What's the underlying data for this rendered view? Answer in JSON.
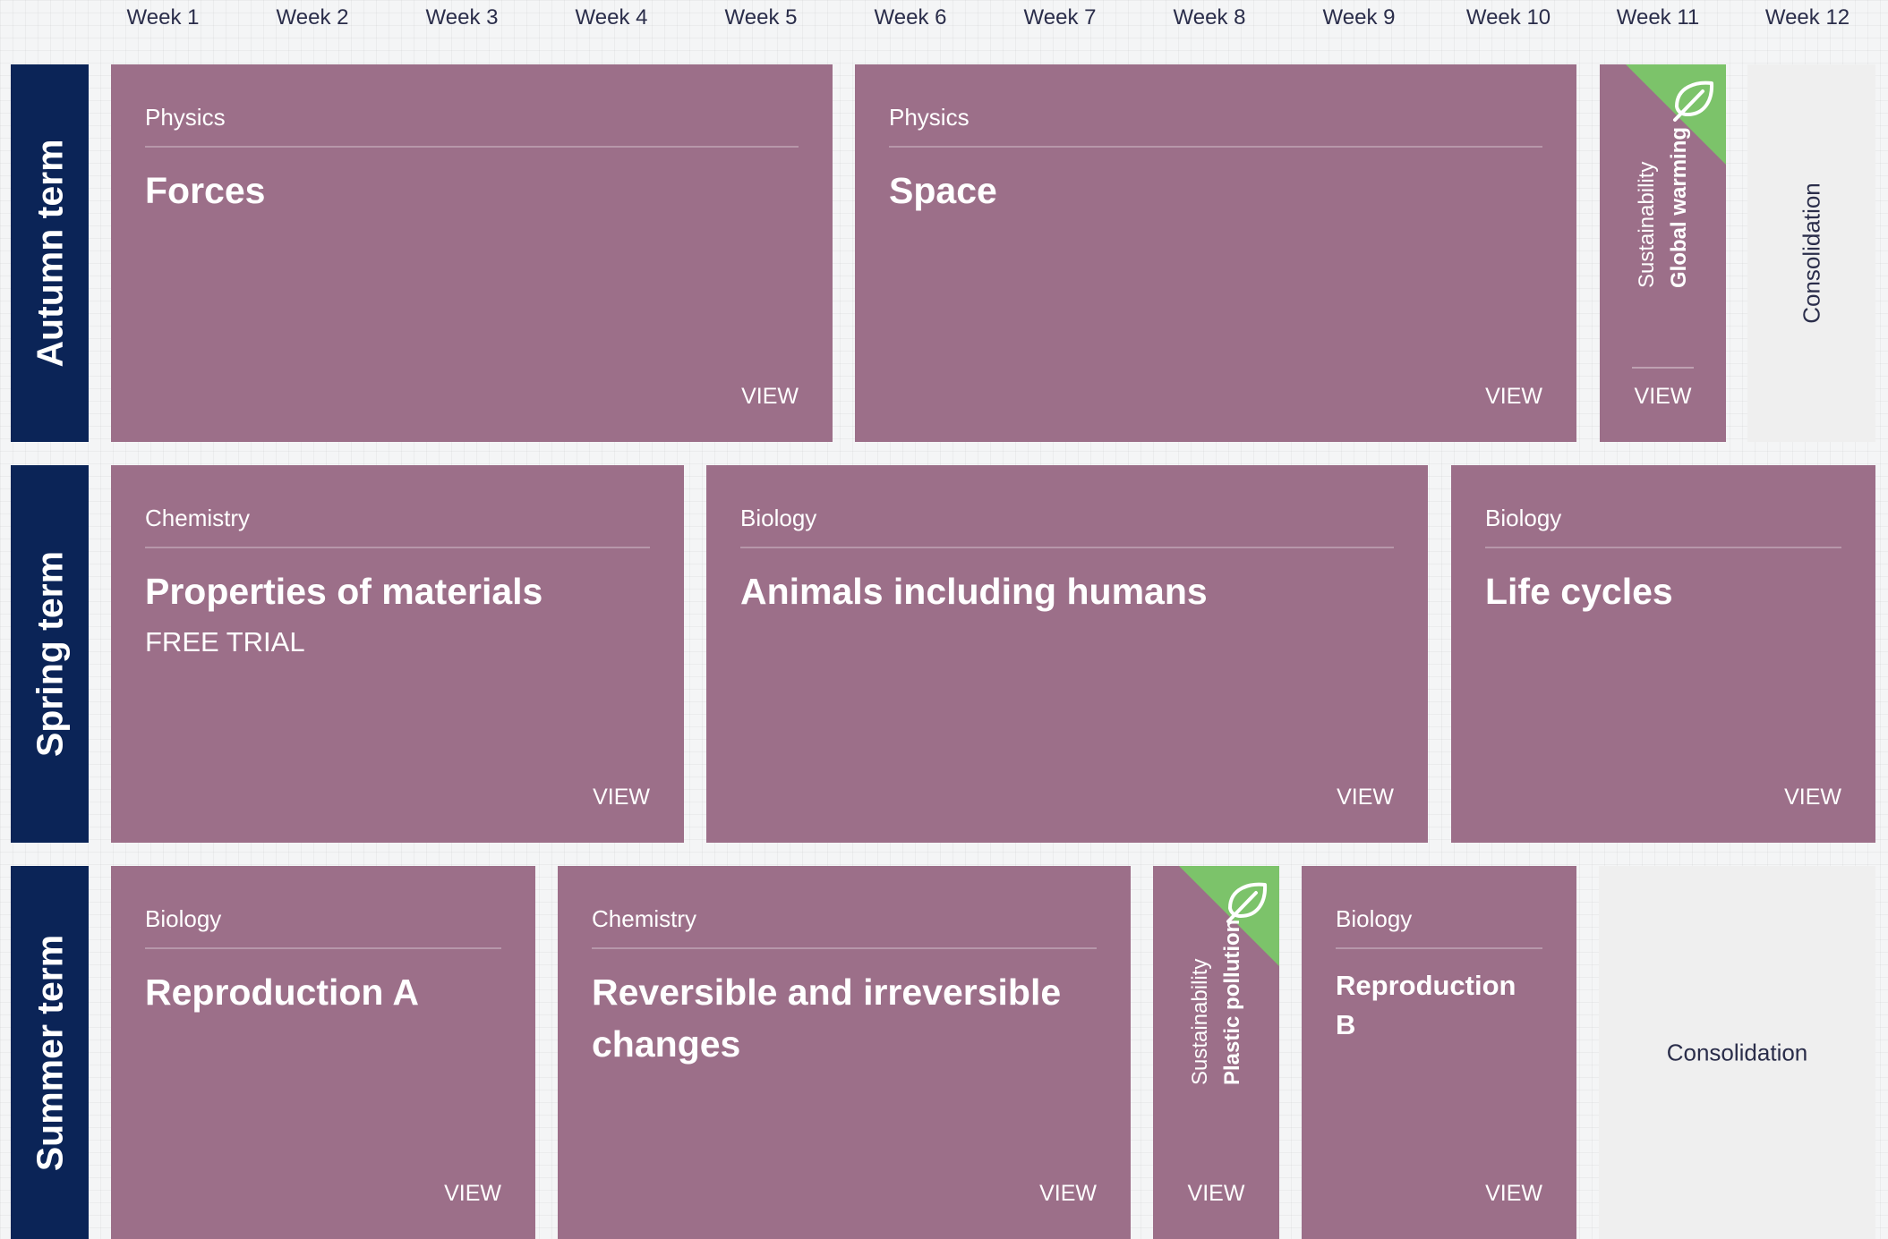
{
  "weeks": [
    "Week 1",
    "Week 2",
    "Week 3",
    "Week 4",
    "Week 5",
    "Week 6",
    "Week 7",
    "Week 8",
    "Week 9",
    "Week 10",
    "Week 11",
    "Week 12"
  ],
  "terms": {
    "autumn": "Autumn term",
    "spring": "Spring term",
    "summer": "Summer term"
  },
  "view_label": "VIEW",
  "cards": {
    "forces": {
      "subject": "Physics",
      "title": "Forces"
    },
    "space": {
      "subject": "Physics",
      "title": "Space"
    },
    "global_warming": {
      "subject": "Sustainability",
      "title": "Global warming",
      "icon": "leaf-icon"
    },
    "properties": {
      "subject": "Chemistry",
      "title": "Properties of materials",
      "tag": "FREE TRIAL"
    },
    "animals": {
      "subject": "Biology",
      "title": "Animals including humans"
    },
    "life_cycles": {
      "subject": "Biology",
      "title": "Life cycles"
    },
    "reproduction_a": {
      "subject": "Biology",
      "title": "Reproduction A"
    },
    "reversible": {
      "subject": "Chemistry",
      "title": "Reversible and irreversible changes"
    },
    "plastic_pollution": {
      "subject": "Sustainability",
      "title": "Plastic pollution",
      "icon": "leaf-icon"
    },
    "reproduction_b": {
      "subject": "Biology",
      "title": "Reproduction B"
    }
  },
  "consolidation_label": "Consolidation",
  "colors": {
    "card": "#9c6f89",
    "term_bar": "#0b2457",
    "sustainability_corner": "#7cc36a",
    "consolidation_bg": "#efefef"
  }
}
